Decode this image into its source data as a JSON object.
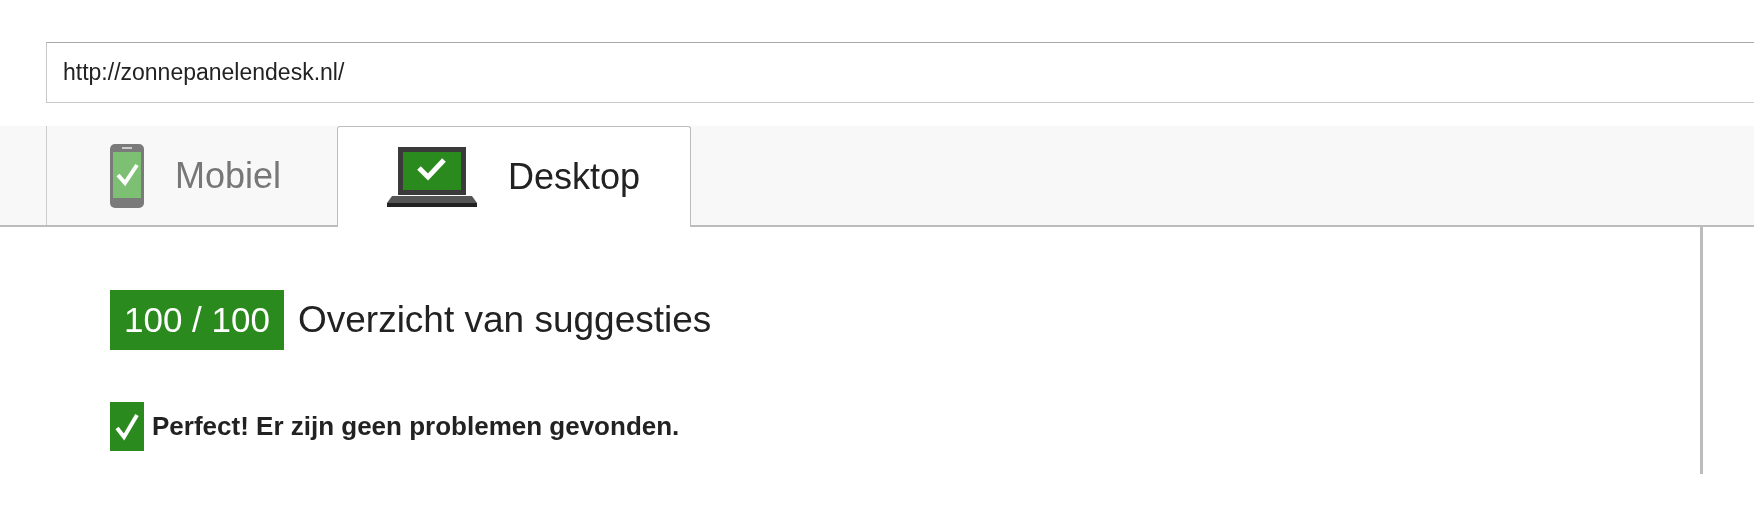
{
  "url_field": {
    "value": "http://zonnepanelendesk.nl/"
  },
  "tabs": [
    {
      "label": "Mobiel",
      "kind": "mobile",
      "selected": false
    },
    {
      "label": "Desktop",
      "kind": "desktop",
      "selected": true
    }
  ],
  "summary": {
    "score": "100 / 100",
    "title": "Overzicht van suggesties",
    "message": "Perfect! Er zijn geen problemen gevonden."
  }
}
